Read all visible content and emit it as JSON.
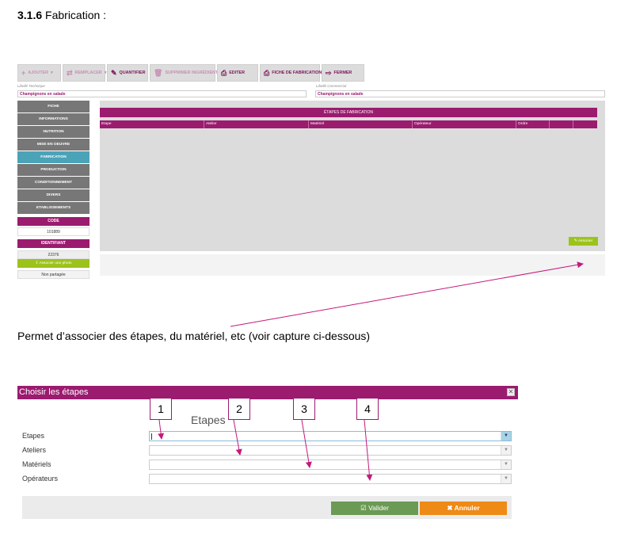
{
  "heading": {
    "number": "3.1.6",
    "title": "Fabrication :"
  },
  "toolbar": {
    "ajouter": "AJOUTER",
    "remplacer": "REMPLACER",
    "quantifier": "QUANTIFIER",
    "supprimer": "SUPPRIMER INGRÉDIENTS",
    "editer": "EDITER",
    "fiche_fabrication": "FICHE DE FABRICATION",
    "fermer": "FERMER"
  },
  "libelles": {
    "technique_label": "Libellé Technique",
    "technique_value": "Champignons en salade",
    "commercial_label": "Libellé Commercial",
    "commercial_value": "Champignons en salade"
  },
  "sidebar": {
    "items": [
      {
        "label": "FICHE"
      },
      {
        "label": "INFORMATIONS"
      },
      {
        "label": "NUTRITION"
      },
      {
        "label": "MISE EN OEUVRE"
      },
      {
        "label": "FABRICATION"
      },
      {
        "label": "PRODUCTION"
      },
      {
        "label": "CONDITIONNEMENT"
      },
      {
        "label": "DIVERS"
      },
      {
        "label": "ETABLISSEMENTS"
      }
    ],
    "active_index": 4,
    "code_label": "CODE",
    "code_value": "101889",
    "identifiant_label": "IDENTIFIANT",
    "identifiant_value": "22376",
    "associer_photo": "Associer une photo",
    "partage": "Non partagée"
  },
  "panel": {
    "title": "ÉTAPES DE FABRICATION",
    "columns": [
      "Etape",
      "Atelier",
      "Matériel",
      "Opérateur",
      "Ordre",
      "",
      ""
    ],
    "associer_button": "Associer"
  },
  "paragraph": "Permet d’associer des étapes, du matériel, etc (voir capture ci-dessous)",
  "dialog": {
    "title": "Choisir les étapes",
    "close": "✕",
    "heading": "Etapes",
    "fields": [
      {
        "label": "Etapes"
      },
      {
        "label": "Ateliers"
      },
      {
        "label": "Matériels"
      },
      {
        "label": "Opérateurs"
      }
    ],
    "valider": "Valider",
    "annuler": "Annuler"
  },
  "callouts": [
    "1",
    "2",
    "3",
    "4"
  ],
  "colors": {
    "brand": "#9b1b6f",
    "active_tab": "#4ba3b8",
    "green": "#9cc31b",
    "valider": "#6a9a53",
    "annuler": "#ee8a16"
  }
}
